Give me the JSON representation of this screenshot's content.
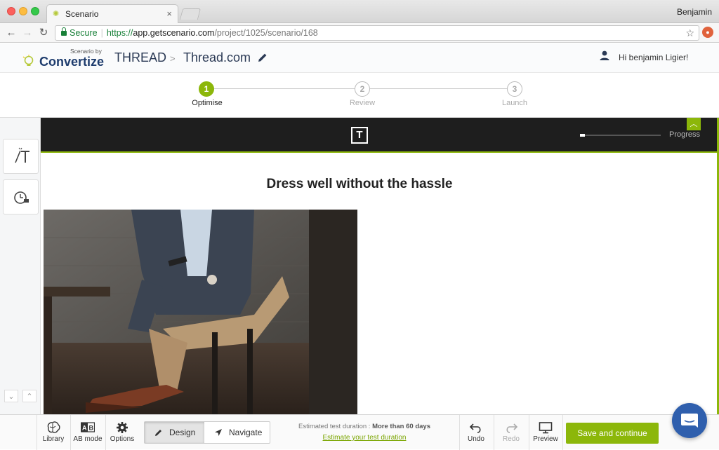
{
  "browser": {
    "tab_title": "Scenario",
    "tab_close": "×",
    "profile_name": "Benjamin",
    "secure_label": "Secure",
    "url_scheme": "https://",
    "url_host": "app.getscenario.com",
    "url_path": "/project/1025/scenario/168"
  },
  "app_header": {
    "logo_small": "Scenario by",
    "logo_main": "Convertize",
    "project_name": "THREAD",
    "breadcrumb_separator": ">",
    "scenario_name": "Thread.com",
    "greeting": "Hi benjamin Ligier!"
  },
  "stepper": {
    "steps": [
      {
        "number": "1",
        "label": "Optimise",
        "state": "active"
      },
      {
        "number": "2",
        "label": "Review",
        "state": "inactive"
      },
      {
        "number": "3",
        "label": "Launch",
        "state": "inactive"
      }
    ]
  },
  "site_preview": {
    "logo_letter": "T",
    "progress_label": "Progress",
    "progress_fraction": 0.06,
    "headline": "Dress well without the hassle"
  },
  "bottom_toolbar": {
    "library_label": "Library",
    "ab_mode_label": "AB mode",
    "options_label": "Options",
    "design_label": "Design",
    "navigate_label": "Navigate",
    "duration_prefix": "Estimated test duration : ",
    "duration_value": "More than 60 days",
    "duration_link": "Estimate your test duration",
    "undo_label": "Undo",
    "redo_label": "Redo",
    "preview_label": "Preview",
    "save_label": "Save and continue"
  },
  "colors": {
    "accent": "#8cb70a",
    "brand_navy": "#1f3d6e",
    "chat": "#2f5fad"
  }
}
